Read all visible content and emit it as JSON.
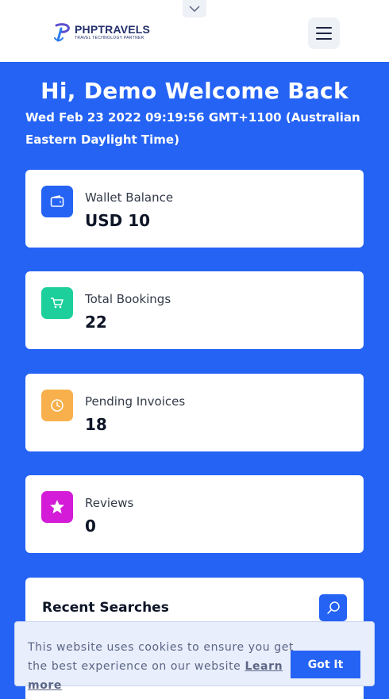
{
  "header": {
    "logo_title": "PHPTRAVELS",
    "logo_subtitle": "TRAVEL TECHNOLOGY PARTNER",
    "logo_color": "#23306b"
  },
  "welcome": {
    "title": "Hi, Demo Welcome Back",
    "datetime": "Wed Feb 23 2022 09:19:56 GMT+1100 (Australian Eastern Daylight Time)"
  },
  "cards": [
    {
      "label": "Wallet Balance",
      "value": "USD 10",
      "icon": "wallet-icon",
      "color": "#2563f4"
    },
    {
      "label": "Total Bookings",
      "value": "22",
      "icon": "cart-icon",
      "color": "#1ccf9b"
    },
    {
      "label": "Pending Invoices",
      "value": "18",
      "icon": "clock-icon",
      "color": "#f7b04b"
    },
    {
      "label": "Reviews",
      "value": "0",
      "icon": "star-icon",
      "color": "#d31bd8"
    }
  ],
  "recent": {
    "title": "Recent Searches",
    "search_icon": "search-icon"
  },
  "cookie": {
    "text": "This website uses cookies to ensure you get the best experience on our website",
    "link": "Learn more",
    "button": "Got It"
  },
  "colors": {
    "primary": "#2563f4",
    "background": "#2563f4"
  }
}
